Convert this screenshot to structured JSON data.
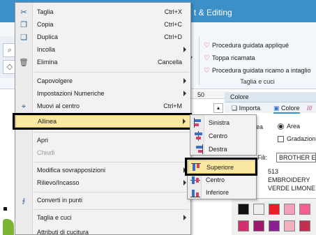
{
  "app": {
    "title": "t & Editing"
  },
  "ribbon": {
    "items": [
      "Procedura guidata appliqué",
      "Toppa ricamata",
      "Procedura guidata ricamo a intaglio"
    ],
    "group_label": "Taglia e cuci"
  },
  "ruler": {
    "mark": "50"
  },
  "panel": {
    "title": "Colore",
    "tabs": [
      "Importa",
      "Colore"
    ],
    "area_label": "ea",
    "radio_area": "Area",
    "check_gradient": "Gradazione",
    "thread_label": "Fili:",
    "thread_value": "BROTHER E",
    "thread_number": "513",
    "thread_line1": "EMBROIDERY",
    "thread_line2": "VERDE LIMONE"
  },
  "context_menu": {
    "items": [
      {
        "label": "Taglia",
        "shortcut": "Ctrl+X",
        "icon": "scissors-icon"
      },
      {
        "label": "Copia",
        "shortcut": "Ctrl+C",
        "icon": "copy-icon"
      },
      {
        "label": "Duplica",
        "shortcut": "Ctrl+D",
        "icon": "duplicate-icon"
      },
      {
        "label": "Incolla",
        "shortcut": "",
        "submenu": true
      },
      {
        "label": "Elimina",
        "shortcut": "Cancella",
        "icon": "trash-icon"
      },
      {
        "label": "Capovolgere",
        "submenu": true
      },
      {
        "label": "Impostazioni Numeriche",
        "submenu": true
      },
      {
        "label": "Muovi al centro",
        "shortcut": "Ctrl+M",
        "icon": "center-icon"
      },
      {
        "label": "Allinea",
        "submenu": true,
        "highlighted": true
      },
      {
        "label": "Apri"
      },
      {
        "label": "Chiudi",
        "disabled": true
      },
      {
        "label": "Modifica sovrapposizioni",
        "submenu": true
      },
      {
        "label": "Rilievo/Incasso",
        "submenu": true
      },
      {
        "label": "Converti in punti",
        "icon": "stitch-icon"
      },
      {
        "label": "Taglia e cuci",
        "submenu": true
      },
      {
        "label": "Attributi di cucitura"
      }
    ]
  },
  "align_submenu": {
    "items": [
      {
        "label": "Sinistra",
        "icon": "align-left-icon"
      },
      {
        "label": "Centro",
        "icon": "align-center-h-icon"
      },
      {
        "label": "Destra",
        "icon": "align-right-icon"
      }
    ],
    "vertical_items": [
      {
        "label": "Superiore",
        "icon": "align-top-icon",
        "highlighted": true
      },
      {
        "label": "Centro",
        "icon": "align-center-v-icon"
      },
      {
        "label": "Inferiore",
        "icon": "align-bottom-icon"
      }
    ]
  },
  "colors": {
    "accent": "#3a90c7",
    "highlight": "#fbe9a3",
    "swatches_row1": [
      "#111111",
      "#eeeeee",
      "#e8202a",
      "#f4a0b8",
      "#f06090"
    ],
    "swatches_row2": [
      "#d03070",
      "#9a1a6a",
      "#8a2090",
      "#f0b0c0",
      "#c03050"
    ]
  }
}
